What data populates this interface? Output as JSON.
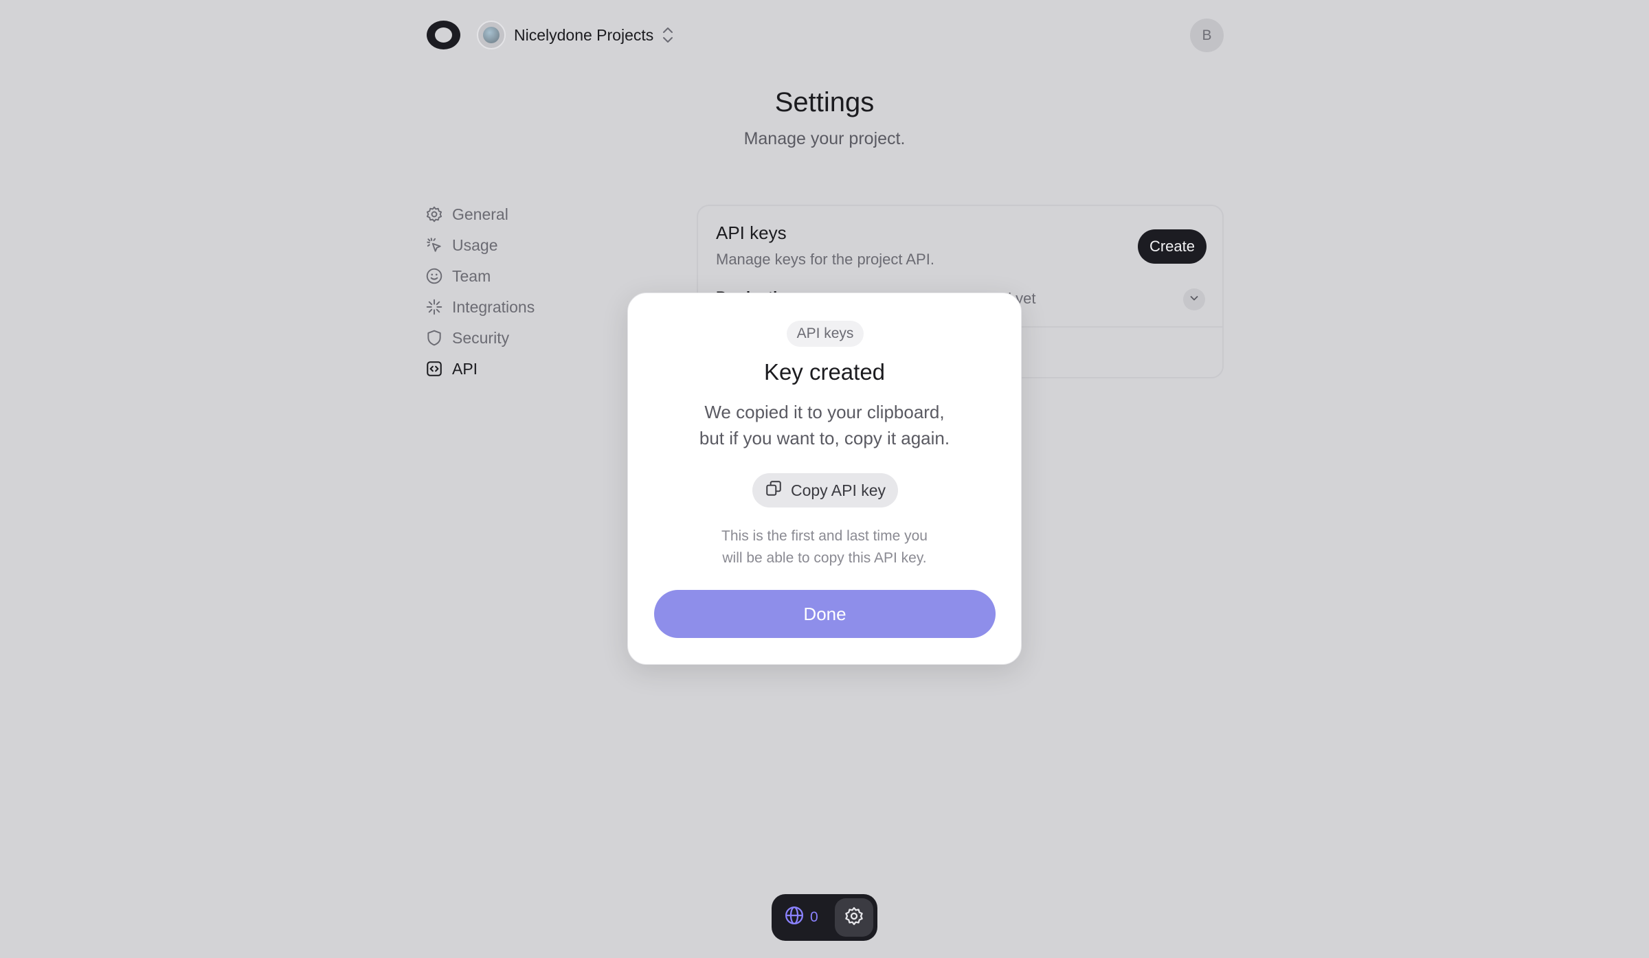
{
  "topbar": {
    "project_name": "Nicelydone Projects",
    "user_initial": "B"
  },
  "header": {
    "title": "Settings",
    "subtitle": "Manage your project."
  },
  "sidebar": {
    "items": [
      {
        "label": "General",
        "icon": "gear-icon"
      },
      {
        "label": "Usage",
        "icon": "cursor-click-icon"
      },
      {
        "label": "Team",
        "icon": "smiley-icon"
      },
      {
        "label": "Integrations",
        "icon": "sparkle-icon"
      },
      {
        "label": "Security",
        "icon": "shield-icon"
      },
      {
        "label": "API",
        "icon": "code-box-icon",
        "active": true
      }
    ]
  },
  "api_card": {
    "title": "API keys",
    "description": "Manage keys for the project API.",
    "create_label": "Create",
    "row_label": "Production",
    "row_status": "Not used yet"
  },
  "modal": {
    "badge": "API keys",
    "title": "Key created",
    "text_line1": "We copied it to your clipboard,",
    "text_line2": "but if you want to, copy it again.",
    "copy_label": "Copy API key",
    "note_line1": "This is the first and last time you",
    "note_line2": "will be able to copy this API key.",
    "done_label": "Done"
  },
  "dock": {
    "globe_count": "0"
  },
  "colors": {
    "background": "#d3d3d6",
    "accent": "#8e8eea",
    "dark": "#1c1c22",
    "dock_accent": "#8b82ff"
  }
}
